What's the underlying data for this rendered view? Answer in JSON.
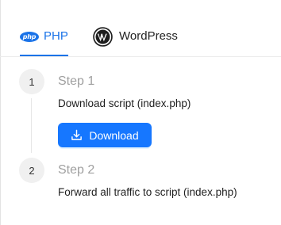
{
  "tabs": {
    "php": {
      "label": "PHP",
      "icon": "php-logo-icon",
      "badge_text": "php"
    },
    "wordpress": {
      "label": "WordPress",
      "icon": "wordpress-logo-icon"
    },
    "active": "php"
  },
  "steps": [
    {
      "number": "1",
      "title": "Step 1",
      "description": "Download script (index.php)"
    },
    {
      "number": "2",
      "title": "Step 2",
      "description": "Forward all traffic to script (index.php)"
    }
  ],
  "download_button": {
    "label": "Download",
    "icon": "download-icon"
  },
  "colors": {
    "accent": "#1a73e8",
    "button": "#1677ff",
    "muted_text": "#a0a0a0",
    "circle_bg": "#f0f0f0"
  }
}
